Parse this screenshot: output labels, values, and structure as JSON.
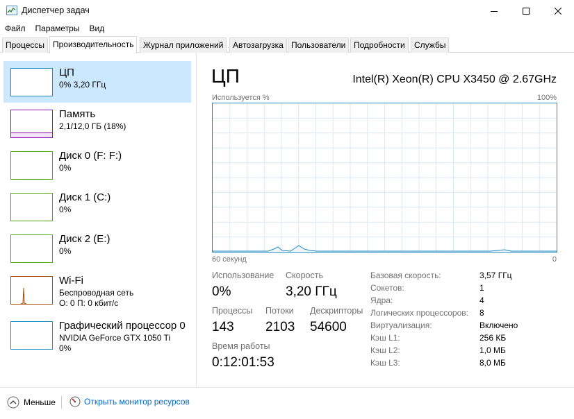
{
  "window": {
    "title": "Диспетчер задач",
    "icons": {
      "app": "taskmanager-icon",
      "minimize": "minimize-icon",
      "maximize": "maximize-icon",
      "close": "close-icon"
    }
  },
  "menu": [
    "Файл",
    "Параметры",
    "Вид"
  ],
  "tabs": [
    "Процессы",
    "Производительность",
    "Журнал приложений",
    "Автозагрузка",
    "Пользователи",
    "Подробности",
    "Службы"
  ],
  "active_tab": "Производительность",
  "resources": [
    {
      "name": "ЦП",
      "sub1": "0% 3,20 ГГц",
      "sub2": "",
      "color": "#1d8bc1",
      "selected": true
    },
    {
      "name": "Память",
      "sub1": "2,1/12,0 ГБ (18%)",
      "sub2": "",
      "color": "#8b12ae",
      "selected": false
    },
    {
      "name": "Диск 0 (F: F:)",
      "sub1": "0%",
      "sub2": "",
      "color": "#4da60c",
      "selected": false
    },
    {
      "name": "Диск 1 (C:)",
      "sub1": "0%",
      "sub2": "",
      "color": "#4da60c",
      "selected": false
    },
    {
      "name": "Диск 2 (E:)",
      "sub1": "0%",
      "sub2": "",
      "color": "#4da60c",
      "selected": false
    },
    {
      "name": "Wi-Fi",
      "sub1": "Беспроводная сеть",
      "sub2": "О: 0 П: 0 кбит/с",
      "color": "#a74f01",
      "selected": false
    },
    {
      "name": "Графический процессор 0",
      "sub1": "NVIDIA GeForce GTX 1050 Ti",
      "sub2": "0%",
      "color": "#1d8bc1",
      "selected": false
    }
  ],
  "main": {
    "title": "ЦП",
    "cpu_model": "Intel(R) Xeon(R) CPU X3450 @ 2.67GHz",
    "graph_label_left": "Используется %",
    "graph_label_right": "100%",
    "graph_bottom_left": "60 секунд",
    "graph_bottom_right": "0",
    "graph_color": "#1d8bc1",
    "stats": {
      "usage_label": "Использование",
      "usage_value": "0%",
      "speed_label": "Скорость",
      "speed_value": "3,20 ГГц",
      "processes_label": "Процессы",
      "processes_value": "143",
      "threads_label": "Потоки",
      "threads_value": "2103",
      "handles_label": "Дескрипторы",
      "handles_value": "54600",
      "uptime_label": "Время работы",
      "uptime_value": "0:12:01:53"
    },
    "specs": [
      {
        "label": "Базовая скорость:",
        "value": "3,57 ГГц"
      },
      {
        "label": "Сокетов:",
        "value": "1"
      },
      {
        "label": "Ядра:",
        "value": "4"
      },
      {
        "label": "Логических процессоров:",
        "value": "8"
      },
      {
        "label": "Виртуализация:",
        "value": "Включено"
      },
      {
        "label": "Кэш L1:",
        "value": "256 КБ"
      },
      {
        "label": "Кэш L2:",
        "value": "1,0 МБ"
      },
      {
        "label": "Кэш L3:",
        "value": "8,0 МБ"
      }
    ]
  },
  "footer": {
    "fewer_label": "Меньше",
    "open_monitor_label": "Открыть монитор ресурсов"
  }
}
